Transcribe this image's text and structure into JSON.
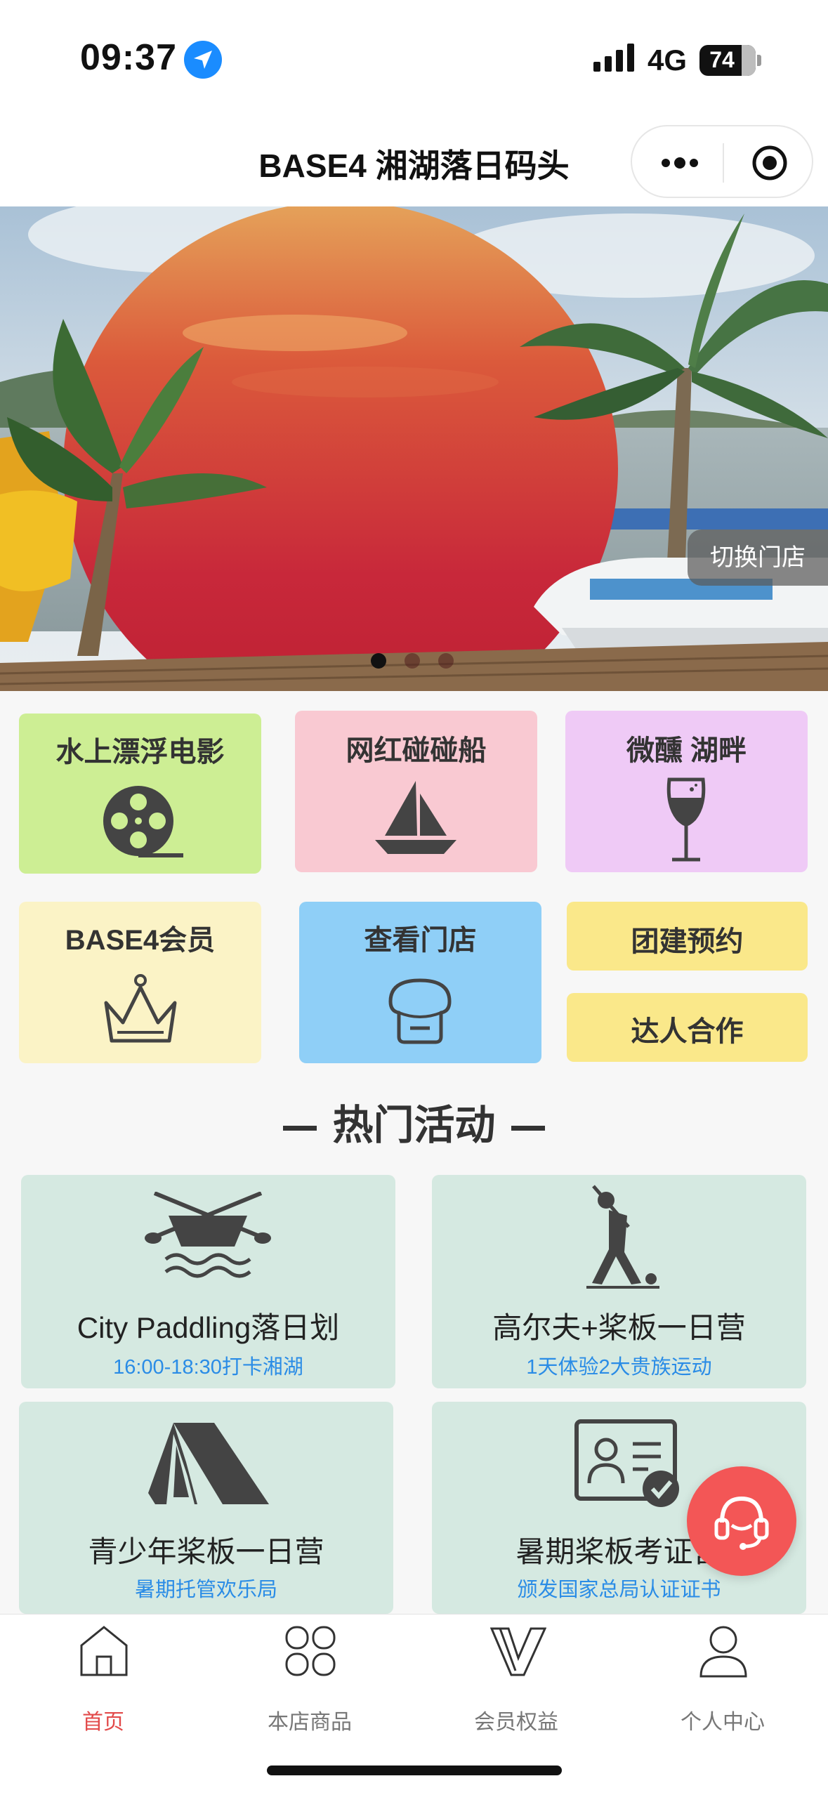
{
  "status_bar": {
    "time": "09:37",
    "network": "4G",
    "battery": "74"
  },
  "header": {
    "title": "BASE4 湘湖落日码头",
    "more_icon": "more-dots-icon",
    "close_icon": "target-icon"
  },
  "banner": {
    "switch_store_label": "切换门店",
    "slide_count": 3,
    "active_slide": 1
  },
  "tiles": [
    {
      "label": "水上漂浮电影",
      "icon": "film-reel-icon",
      "color": "#cdee94"
    },
    {
      "label": "网红碰碰船",
      "icon": "sailboat-icon",
      "color": "#f9c9d2"
    },
    {
      "label": "微醺 湖畔",
      "icon": "wine-glass-icon",
      "color": "#efcaf6"
    },
    {
      "label": "BASE4会员",
      "icon": "crown-icon",
      "color": "#fbf3c6"
    },
    {
      "label": "查看门店",
      "icon": "store-icon",
      "color": "#8fcff7"
    },
    {
      "label": "团建预约",
      "icon": "",
      "color": "#fae88a"
    },
    {
      "label": "达人合作",
      "icon": "",
      "color": "#fae88a"
    }
  ],
  "section": {
    "title": "热门活动"
  },
  "activities": [
    {
      "title": "City Paddling落日划",
      "subtitle": "16:00-18:30打卡湘湖",
      "icon": "paddle-boat-icon"
    },
    {
      "title": "高尔夫+桨板一日营",
      "subtitle": "1天体验2大贵族运动",
      "icon": "golfer-icon"
    },
    {
      "title": "青少年桨板一日营",
      "subtitle": "暑期托管欢乐局",
      "icon": "tent-icon"
    },
    {
      "title": "暑期桨板考证营",
      "subtitle": "颁发国家总局认证证书",
      "icon": "certificate-icon"
    }
  ],
  "fab": {
    "icon": "customer-service-icon",
    "color": "#f35656"
  },
  "tab_bar": {
    "items": [
      {
        "label": "首页",
        "icon": "home-icon",
        "active": true
      },
      {
        "label": "本店商品",
        "icon": "grid-icon",
        "active": false
      },
      {
        "label": "会员权益",
        "icon": "vip-icon",
        "active": false
      },
      {
        "label": "个人中心",
        "icon": "user-icon",
        "active": false
      }
    ],
    "active_color": "#e24a4a"
  }
}
